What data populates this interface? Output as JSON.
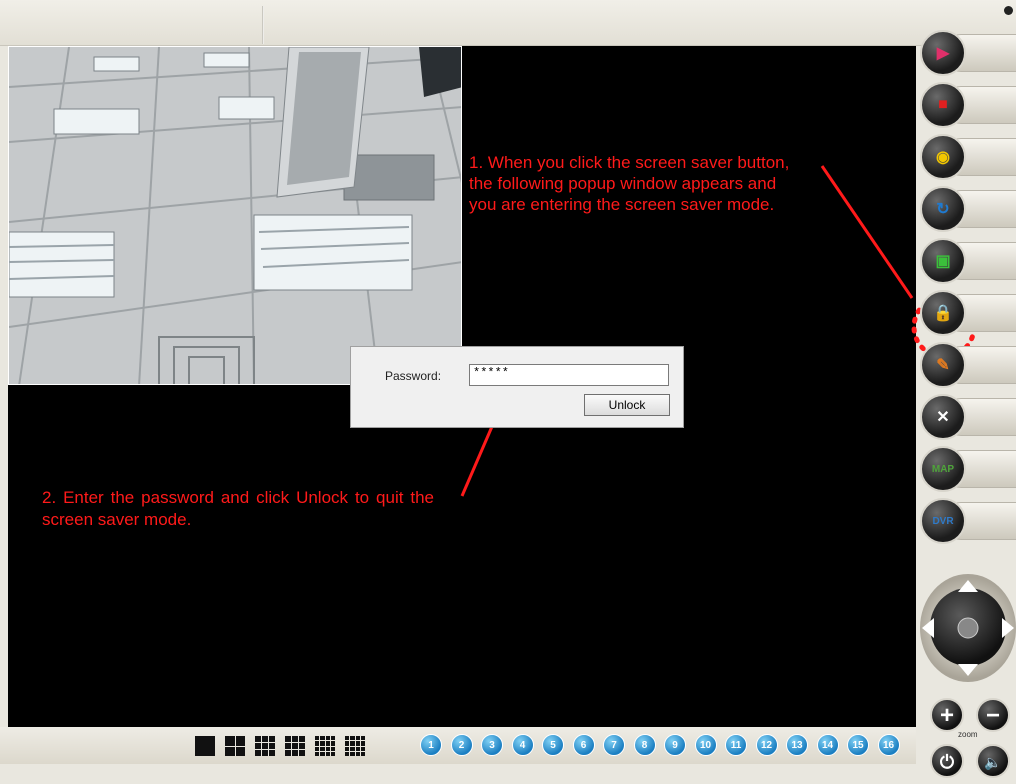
{
  "annotations": {
    "note1": "1. When you click the screen saver button, the following popup window appears and you are entering the screen saver mode.",
    "note2": "2. Enter the password and click Unlock to quit the screen saver mode."
  },
  "popup": {
    "password_label": "Password:",
    "password_value": "*****",
    "unlock_label": "Unlock"
  },
  "sidebar": {
    "buttons": [
      {
        "icon": "play-icon",
        "glyph": "▶",
        "color": "#e0306a"
      },
      {
        "icon": "record-video-icon",
        "glyph": "■",
        "color": "#e02020"
      },
      {
        "icon": "snapshot-camera-icon",
        "glyph": "◉",
        "color": "#f2c700"
      },
      {
        "icon": "rotate-180-icon",
        "glyph": "↻",
        "color": "#1f7ad0"
      },
      {
        "icon": "full-screen-icon",
        "glyph": "▣",
        "color": "#3bbf3b"
      },
      {
        "icon": "screen-saver-lock-icon",
        "glyph": "🔒",
        "color": "#ffffff"
      },
      {
        "icon": "edit-icon",
        "glyph": "✎",
        "color": "#e07a20"
      },
      {
        "icon": "settings-tools-icon",
        "glyph": "✕",
        "color": "#ffffff"
      },
      {
        "icon": "map-icon",
        "glyph": "MAP",
        "color": "#4fa33b"
      },
      {
        "icon": "dvr-icon",
        "glyph": "DVR",
        "color": "#2f7ac8"
      }
    ],
    "zoom_label": "zoom",
    "zoom_in": "+",
    "zoom_out": "−",
    "power": "⏻",
    "speaker": "🔈"
  },
  "bottombar": {
    "layouts": [
      {
        "name": "layout-1x1",
        "cols": 1,
        "cells": 1
      },
      {
        "name": "layout-2x2",
        "cols": 2,
        "cells": 4
      },
      {
        "name": "layout-1plus5",
        "cols": 3,
        "cells": 9
      },
      {
        "name": "layout-3x3",
        "cols": 3,
        "cells": 9
      },
      {
        "name": "layout-1plus12",
        "cols": 4,
        "cells": 16
      },
      {
        "name": "layout-4x4",
        "cols": 4,
        "cells": 16
      }
    ],
    "channels": [
      "1",
      "2",
      "3",
      "4",
      "5",
      "6",
      "7",
      "8",
      "9",
      "10",
      "11",
      "12",
      "13",
      "14",
      "15",
      "16"
    ]
  }
}
